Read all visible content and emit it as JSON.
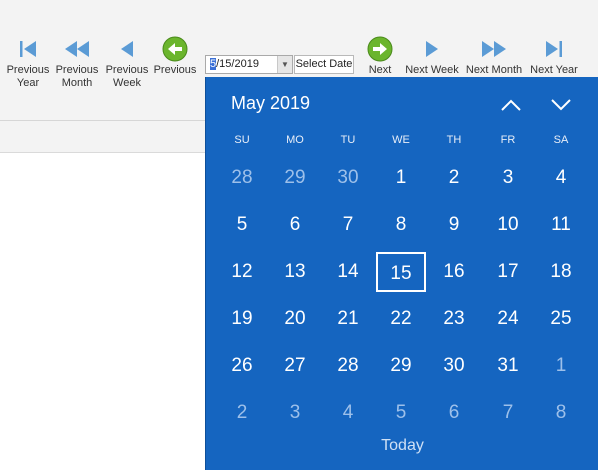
{
  "ribbon": {
    "left_buttons": [
      {
        "name": "previous-year-button",
        "icon": "first-triangle-icon",
        "label": "Previous\nYear"
      },
      {
        "name": "previous-month-button",
        "icon": "double-left-icon",
        "label": "Previous\nMonth"
      },
      {
        "name": "previous-week-button",
        "icon": "left-triangle-icon",
        "label": "Previous\nWeek"
      },
      {
        "name": "previous-day-button",
        "icon": "green-left-arrow-icon",
        "label": "Previous"
      }
    ],
    "right_buttons": [
      {
        "name": "next-day-button",
        "icon": "green-right-arrow-icon",
        "label": "Next"
      },
      {
        "name": "next-week-button",
        "icon": "right-triangle-icon",
        "label": "Next Week"
      },
      {
        "name": "next-month-button",
        "icon": "double-right-icon",
        "label": "Next Month"
      },
      {
        "name": "next-year-button",
        "icon": "last-triangle-icon",
        "label": "Next Year"
      }
    ],
    "date_edit": {
      "cursor_char": "5",
      "rest": "/15/2019"
    },
    "select_date_label": "Select Date"
  },
  "calendar": {
    "month_label": "May 2019",
    "weekdays": [
      "SU",
      "MO",
      "TU",
      "WE",
      "TH",
      "FR",
      "SA"
    ],
    "weeks": [
      [
        {
          "d": "28",
          "o": true
        },
        {
          "d": "29",
          "o": true
        },
        {
          "d": "30",
          "o": true
        },
        {
          "d": "1"
        },
        {
          "d": "2"
        },
        {
          "d": "3"
        },
        {
          "d": "4"
        }
      ],
      [
        {
          "d": "5"
        },
        {
          "d": "6"
        },
        {
          "d": "7"
        },
        {
          "d": "8"
        },
        {
          "d": "9"
        },
        {
          "d": "10"
        },
        {
          "d": "11"
        }
      ],
      [
        {
          "d": "12"
        },
        {
          "d": "13"
        },
        {
          "d": "14"
        },
        {
          "d": "15",
          "sel": true
        },
        {
          "d": "16"
        },
        {
          "d": "17"
        },
        {
          "d": "18"
        }
      ],
      [
        {
          "d": "19"
        },
        {
          "d": "20"
        },
        {
          "d": "21"
        },
        {
          "d": "22"
        },
        {
          "d": "23"
        },
        {
          "d": "24"
        },
        {
          "d": "25"
        }
      ],
      [
        {
          "d": "26"
        },
        {
          "d": "27"
        },
        {
          "d": "28"
        },
        {
          "d": "29"
        },
        {
          "d": "30"
        },
        {
          "d": "31"
        },
        {
          "d": "1",
          "o": true
        }
      ],
      [
        {
          "d": "2",
          "o": true
        },
        {
          "d": "3",
          "o": true
        },
        {
          "d": "4",
          "o": true
        },
        {
          "d": "5",
          "o": true
        },
        {
          "d": "6",
          "o": true
        },
        {
          "d": "7",
          "o": true
        },
        {
          "d": "8",
          "o": true
        }
      ]
    ],
    "today_label": "Today",
    "colors": {
      "background": "#1565c0",
      "other_month": "#9dc0ea",
      "icon_blue": "#5b9bd5",
      "icon_green": "#6bb52d"
    }
  }
}
